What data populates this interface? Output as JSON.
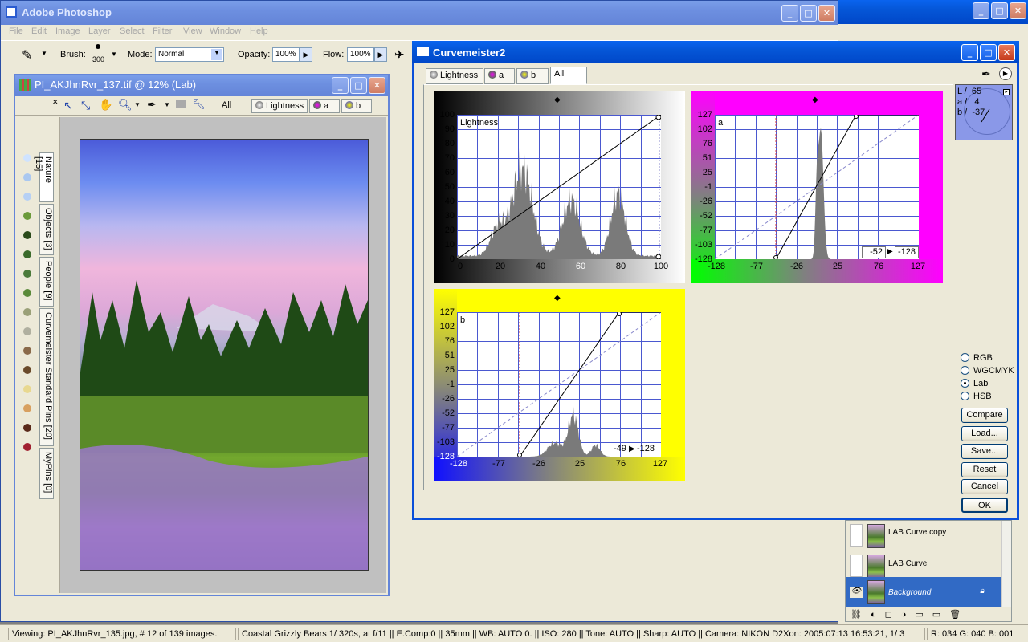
{
  "ps": {
    "title": "Adobe Photoshop",
    "menu": [
      "File",
      "Edit",
      "Image",
      "Layer",
      "Select",
      "Filter",
      "View",
      "Window",
      "Help"
    ],
    "options": {
      "brush_label": "Brush:",
      "brush_size": "300",
      "mode_label": "Mode:",
      "mode_value": "Normal",
      "opacity_label": "Opacity:",
      "opacity_value": "100%",
      "flow_label": "Flow:",
      "flow_value": "100%"
    }
  },
  "doc": {
    "title": "PI_AKJhnRvr_137.tif @ 12% (Lab)",
    "tabs": [
      "All",
      "Lightness",
      "a",
      "b"
    ],
    "side_tabs": [
      "Nature [15]",
      "Objects [3]",
      "People [9]",
      "Curvemeister Standard Pins [20]",
      "MyPins [0]"
    ]
  },
  "cm": {
    "title": "Curvemeister2",
    "tabs": [
      "Lightness",
      "a",
      "b",
      "All"
    ],
    "active_tab": "All",
    "readout": {
      "L": "L /  65",
      "a": "a /   4",
      "b": "b /  -37"
    },
    "color_modes": [
      "RGB",
      "WGCMYK",
      "Lab",
      "HSB"
    ],
    "selected_mode": "Lab",
    "buttons": [
      "Compare",
      "Load...",
      "Save...",
      "Reset",
      "Cancel",
      "OK"
    ],
    "panels": {
      "lightness": {
        "label": "Lightness",
        "y_ticks": [
          "100",
          "90",
          "80",
          "70",
          "60",
          "50",
          "40",
          "30",
          "20",
          "10",
          "0"
        ],
        "x_ticks": [
          "0",
          "20",
          "40",
          "60",
          "80",
          "100"
        ]
      },
      "a": {
        "label": "a",
        "y_ticks": [
          "127",
          "102",
          "76",
          "51",
          "25",
          "-1",
          "-26",
          "-52",
          "-77",
          "-103",
          "-128"
        ],
        "x_ticks": [
          "-128",
          "-77",
          "-26",
          "25",
          "76",
          "127"
        ],
        "point_in": "-52",
        "point_out": "-128"
      },
      "b": {
        "label": "b",
        "y_ticks": [
          "127",
          "102",
          "76",
          "51",
          "25",
          "-1",
          "-26",
          "-52",
          "-77",
          "-103",
          "-128"
        ],
        "x_ticks": [
          "-128",
          "-77",
          "-26",
          "25",
          "76",
          "127"
        ],
        "point_in": "-49",
        "point_out": "-128"
      }
    }
  },
  "layers": [
    {
      "name": "LAB Curve copy",
      "visible": false,
      "selected": false
    },
    {
      "name": "LAB Curve",
      "visible": false,
      "selected": false
    },
    {
      "name": "Background",
      "visible": true,
      "selected": true
    }
  ],
  "status": {
    "viewing": "Viewing: PI_AKJhnRvr_135.jpg, # 12 of 139 images.",
    "info": "Coastal Grizzly Bears 1/ 320s, at f/11 || E.Comp:0 || 35mm || WB: AUTO 0. || ISO: 280 || Tone: AUTO || Sharp: AUTO || Camera: NIKON D2Xon: 2005:07:13 16:53:21, 1/ 3",
    "rgb": "R: 034 G: 040 B: 001"
  },
  "colors": {
    "a_panel": "#ff00ff",
    "b_panel": "#ffff00",
    "grid": "#4a58d0"
  }
}
